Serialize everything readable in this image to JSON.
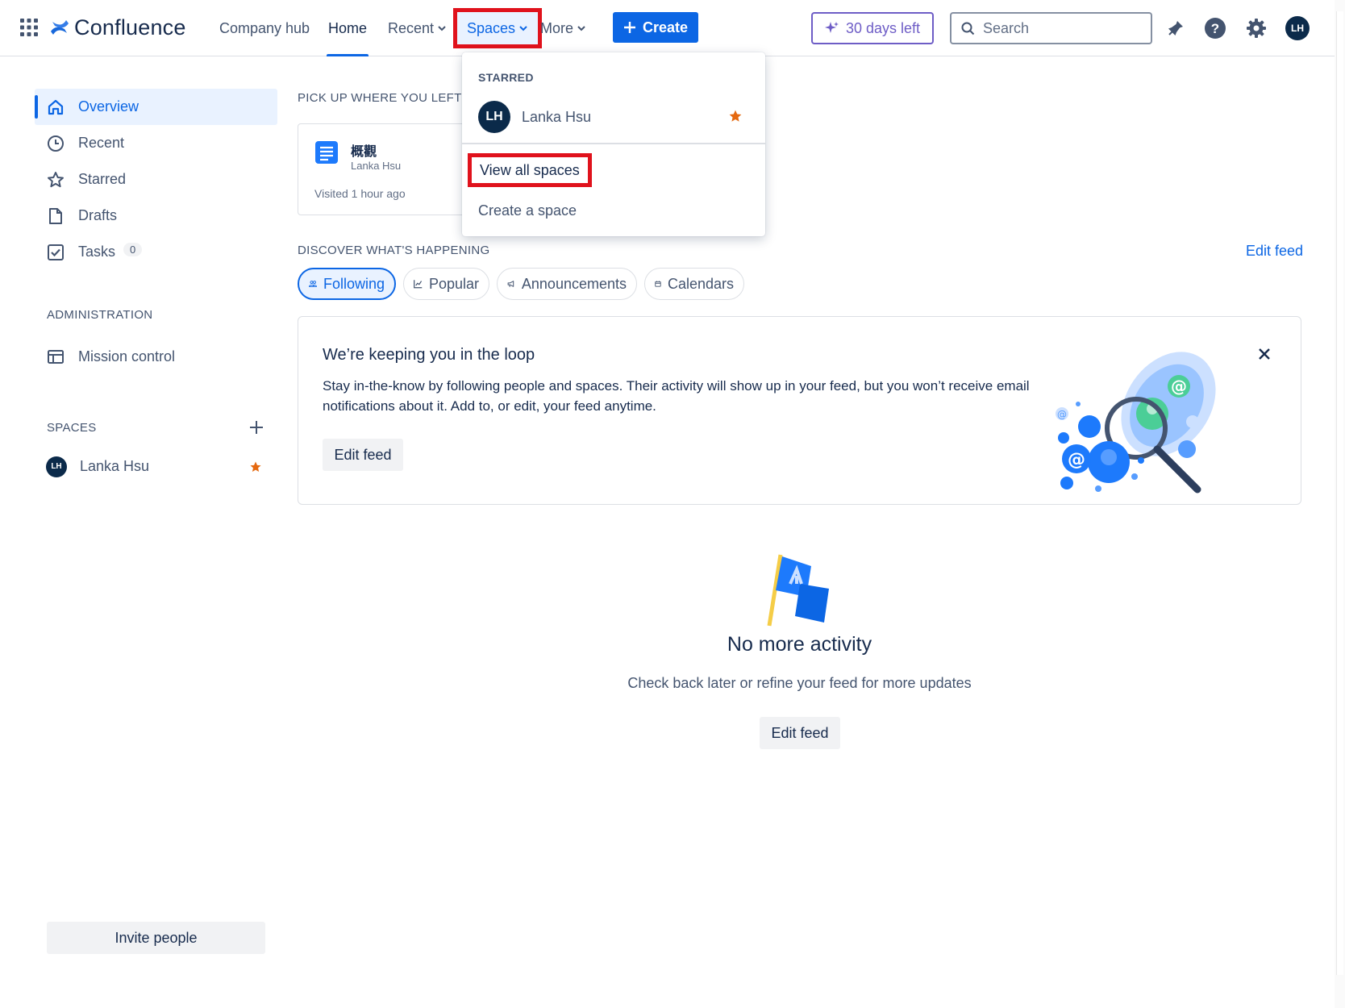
{
  "nav": {
    "logo_text": "Confluence",
    "links": {
      "company_hub": "Company hub",
      "home": "Home",
      "recent": "Recent",
      "spaces": "Spaces",
      "more": "More"
    },
    "create_label": "Create",
    "trial_label": "30 days left",
    "search_placeholder": "Search",
    "user_initials": "LH",
    "colors": {
      "primary": "#0c66e4",
      "trial": "#6e5dc6",
      "highlight": "#e0121c"
    }
  },
  "sidebar": {
    "items": [
      {
        "label": "Overview",
        "icon": "home-icon"
      },
      {
        "label": "Recent",
        "icon": "clock-icon"
      },
      {
        "label": "Starred",
        "icon": "star-icon"
      },
      {
        "label": "Drafts",
        "icon": "draft-icon"
      },
      {
        "label": "Tasks",
        "icon": "task-checkbox-icon",
        "badge": "0"
      }
    ],
    "administration_heading": "ADMINISTRATION",
    "mission_control": "Mission control",
    "spaces_heading": "SPACES",
    "space": {
      "initials": "LH",
      "name": "Lanka Hsu"
    },
    "invite_label": "Invite people"
  },
  "main": {
    "pickup_heading": "PICK UP WHERE YOU LEFT OFF",
    "recent_card": {
      "title": "概觀",
      "author": "Lanka Hsu",
      "visited": "Visited 1 hour ago"
    },
    "discover_heading": "DISCOVER WHAT'S HAPPENING",
    "edit_feed_link": "Edit feed",
    "tabs": [
      {
        "label": "Following",
        "icon": "people-icon",
        "active": true
      },
      {
        "label": "Popular",
        "icon": "chart-icon",
        "active": false
      },
      {
        "label": "Announcements",
        "icon": "megaphone-icon",
        "active": false
      },
      {
        "label": "Calendars",
        "icon": "calendar-icon",
        "active": false
      }
    ],
    "loop_card": {
      "title": "We’re keeping you in the loop",
      "text": "Stay in-the-know by following people and spaces. Their activity will show up in your feed, but you won’t receive email notifications about it. Add to, or edit, your feed anytime.",
      "button": "Edit feed"
    },
    "empty": {
      "title": "No more activity",
      "subtitle": "Check back later or refine your feed for more updates",
      "button": "Edit feed"
    }
  },
  "dropdown": {
    "starred_heading": "STARRED",
    "space": {
      "initials": "LH",
      "name": "Lanka Hsu"
    },
    "view_all": "View all spaces",
    "create_space": "Create a space"
  }
}
